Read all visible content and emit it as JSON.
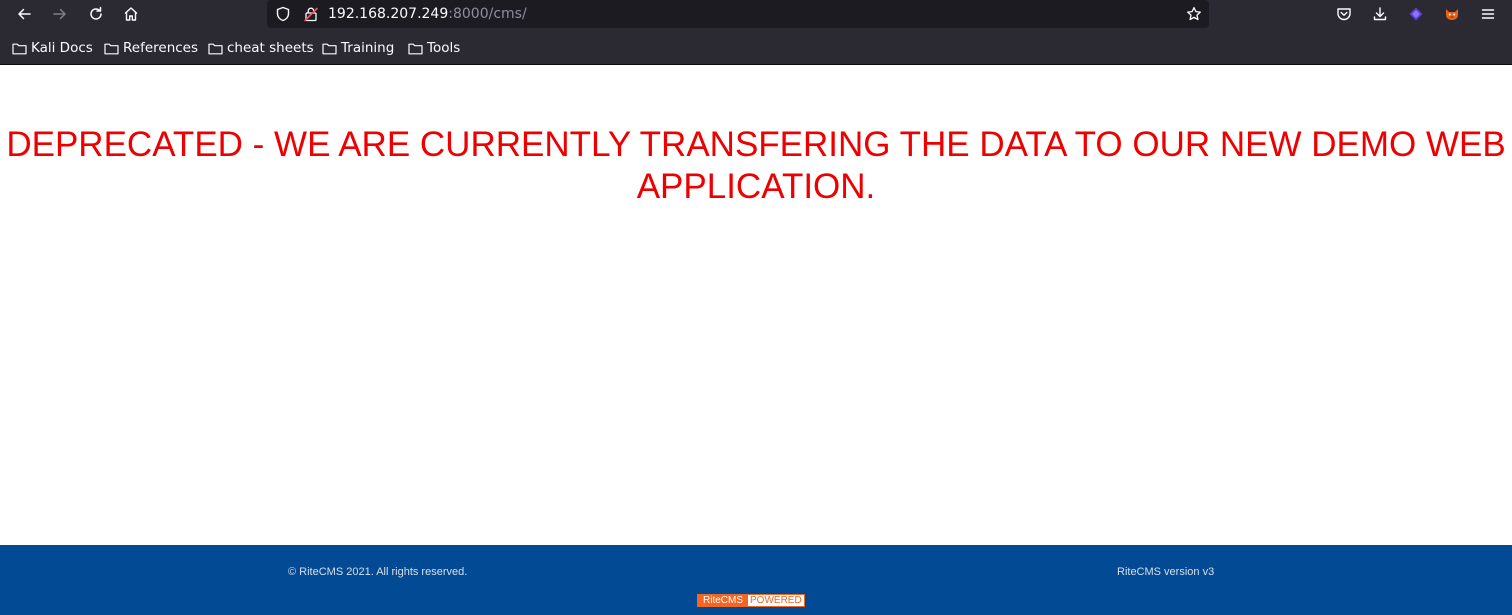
{
  "browser": {
    "nav": {
      "back": "back-icon",
      "forward": "forward-icon",
      "reload": "reload-icon",
      "home": "home-icon"
    },
    "url": {
      "host": "192.168.207.249",
      "rest": ":8000/cms/"
    },
    "right_icons": [
      "pocket-icon",
      "download-icon",
      "extension-icon",
      "foxyproxy-icon",
      "menu-icon"
    ],
    "bookmarks": [
      {
        "label": "Kali Docs"
      },
      {
        "label": "References"
      },
      {
        "label": "cheat sheets"
      },
      {
        "label": "Training"
      },
      {
        "label": "Tools"
      }
    ]
  },
  "page": {
    "headline": "DEPRECATED - WE ARE CURRENTLY TRANSFERING THE DATA TO OUR NEW DEMO WEB APPLICATION.",
    "headline_color": "#ee0000"
  },
  "footer": {
    "copyright": "© RiteCMS 2021. All rights reserved.",
    "version": "RiteCMS version v3",
    "badge_left": "RiteCMS",
    "badge_right": "POWERED",
    "background": "#024b94",
    "badge_color": "#f26522"
  }
}
